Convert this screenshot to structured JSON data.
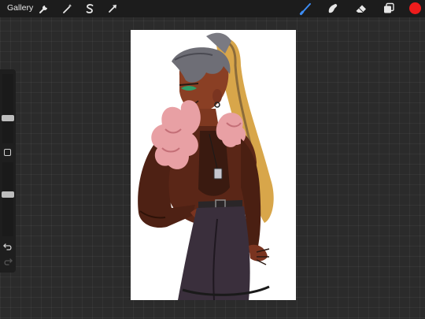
{
  "topbar": {
    "gallery_label": "Gallery",
    "left_tools": [
      {
        "icon": "wrench-icon",
        "name": "actions"
      },
      {
        "icon": "magic-wand-icon",
        "name": "adjustments"
      },
      {
        "icon": "selection-s-icon",
        "name": "selection"
      },
      {
        "icon": "transform-arrow-icon",
        "name": "transform"
      }
    ],
    "right_tools": [
      {
        "icon": "brush-icon",
        "name": "paint",
        "active": true
      },
      {
        "icon": "smudge-icon",
        "name": "smudge"
      },
      {
        "icon": "eraser-icon",
        "name": "eraser"
      },
      {
        "icon": "layers-icon",
        "name": "layers"
      }
    ],
    "current_color": "#ee1c1c",
    "active_tool_color": "#3d8df5"
  },
  "sidebar": {
    "brush_size_level": 0.35,
    "opacity_level": 0.45,
    "icons": [
      "modify-square-icon",
      "undo-icon",
      "redo-icon"
    ]
  },
  "canvas": {
    "background": "#ffffff",
    "artwork": "character-illustration"
  }
}
